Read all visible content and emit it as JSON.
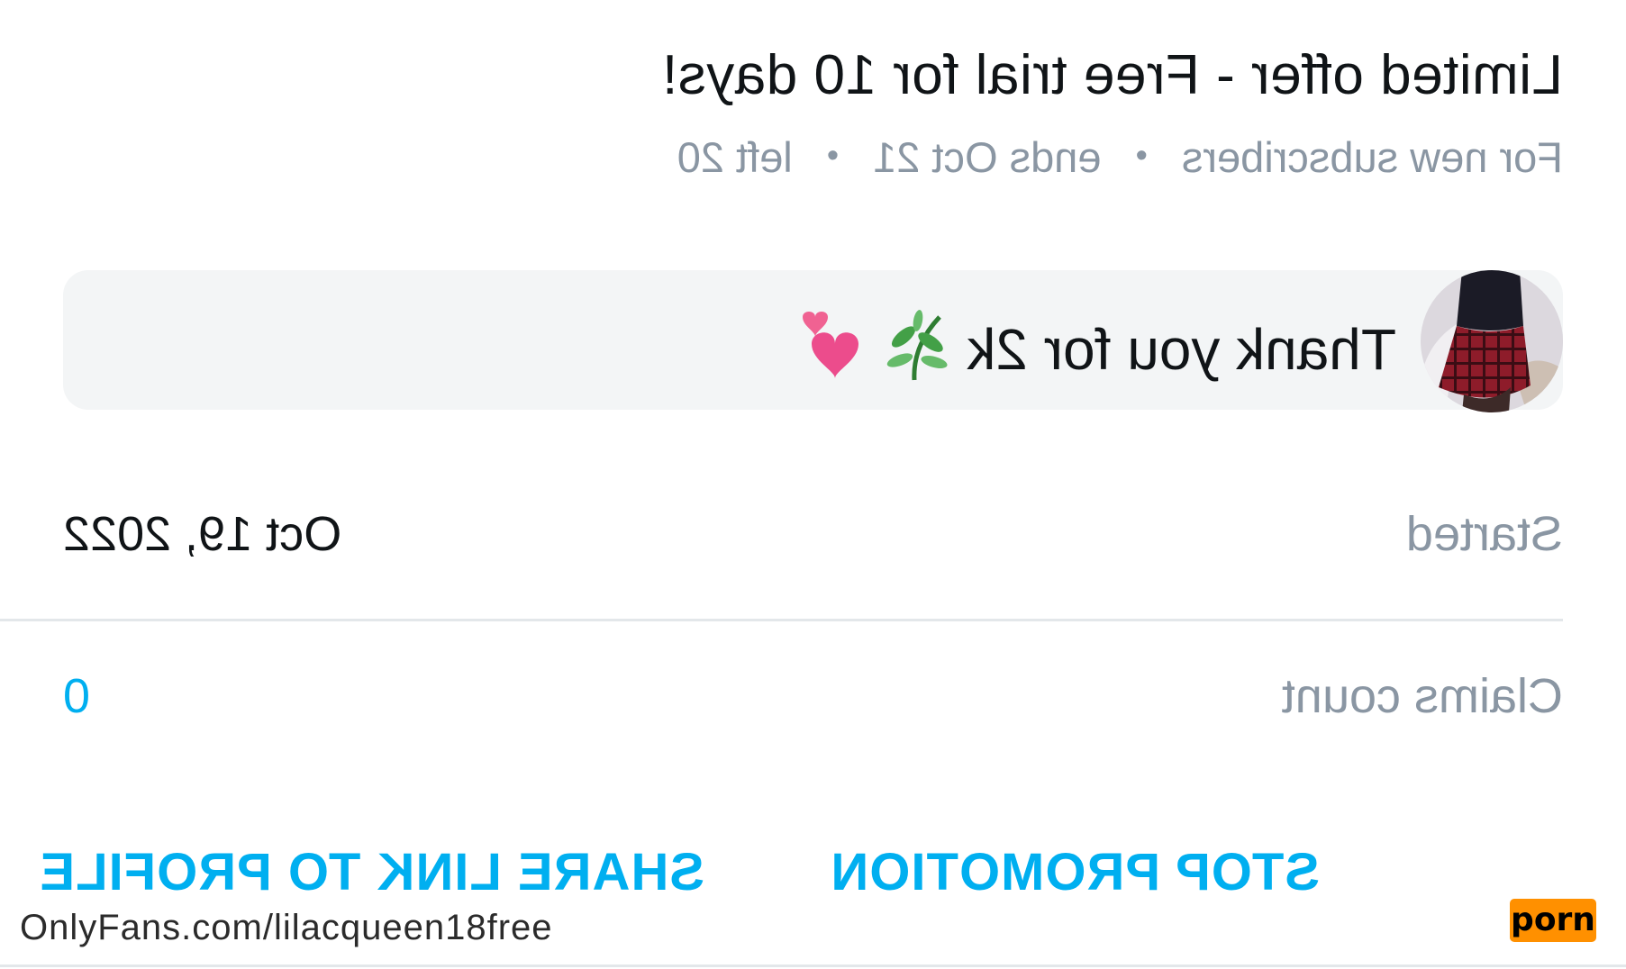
{
  "offer": {
    "title": "Limited offer - Free trial for 10 days!",
    "audience": "For new subscribers",
    "ends": "ends Oct 21",
    "remaining": "left 20",
    "separator": "•"
  },
  "message": {
    "text": "Thank you for 2k",
    "emojis": "🌿💕"
  },
  "details": {
    "started_label": "Started",
    "started_value": "Oct 19, 2022",
    "claims_label": "Claims count",
    "claims_value": "0"
  },
  "actions": {
    "stop_label": "STOP PROMOTION",
    "share_label": "SHARE LINK TO PROFILE"
  },
  "watermark": {
    "url": "OnlyFans.com/lilacqueen18free",
    "logo": "porn"
  },
  "colors": {
    "accent": "#00aff0",
    "muted_text": "#8a96a3",
    "primary_text": "#101417",
    "card_bg": "#f3f5f6",
    "logo_bg": "#ff9000"
  },
  "icons": {
    "avatar": "profile-avatar-photo",
    "emoji": "herb-and-two-hearts"
  }
}
